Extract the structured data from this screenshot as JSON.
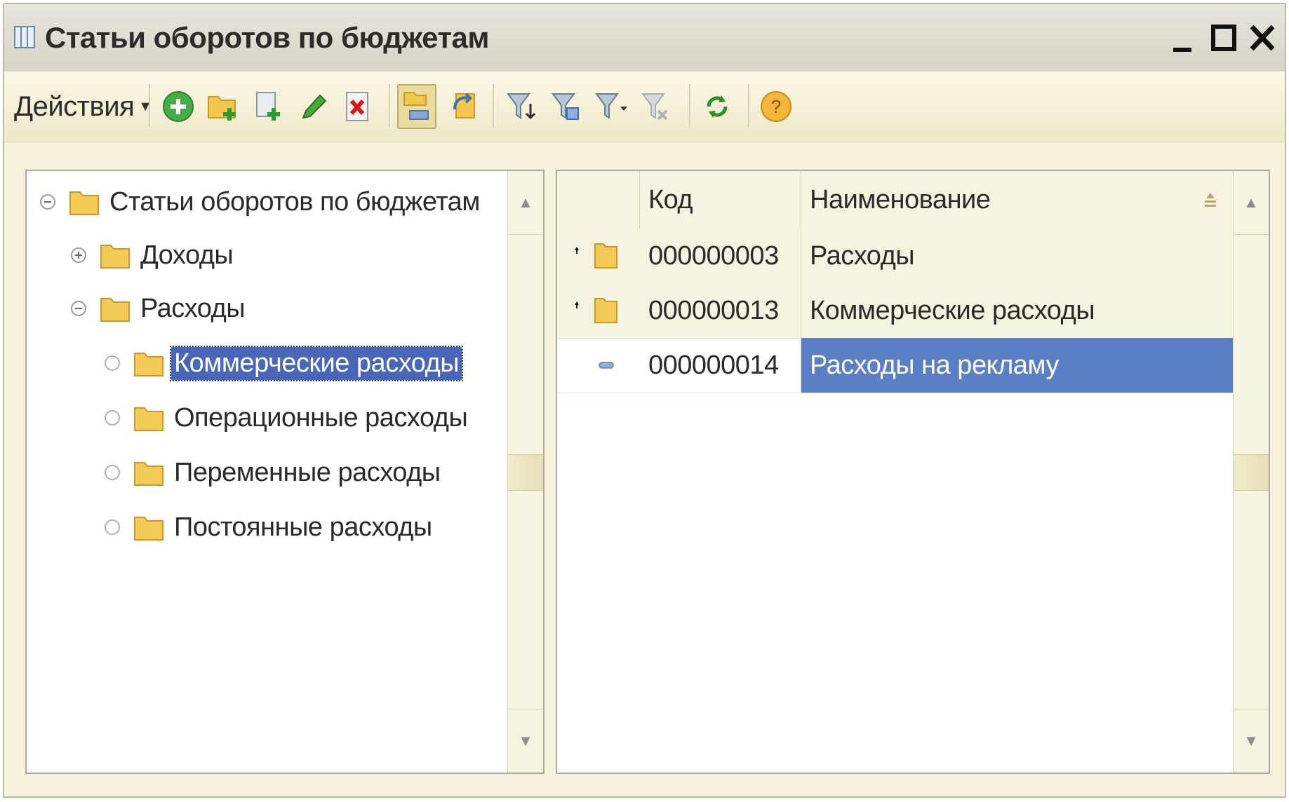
{
  "window": {
    "title": "Статьи оборотов по бюджетам",
    "minimize": "_",
    "close": "X"
  },
  "toolbar": {
    "actions_label": "Действия",
    "buttons": [
      {
        "name": "add-icon"
      },
      {
        "name": "add-group-icon"
      },
      {
        "name": "copy-icon"
      },
      {
        "name": "edit-icon"
      },
      {
        "name": "delete-icon"
      },
      {
        "name": "hierarchy-icon"
      },
      {
        "name": "level-up-icon"
      },
      {
        "name": "filter-icon"
      },
      {
        "name": "filter-by-value-icon"
      },
      {
        "name": "filter-history-icon"
      },
      {
        "name": "clear-filter-icon"
      },
      {
        "name": "refresh-icon"
      },
      {
        "name": "help-icon"
      }
    ],
    "accent": "#3aa43a"
  },
  "tree": {
    "items": [
      {
        "label": "Статьи оборотов по бюджетам",
        "level": 0,
        "state": "expanded"
      },
      {
        "label": "Доходы",
        "level": 1,
        "state": "collapsed"
      },
      {
        "label": "Расходы",
        "level": 1,
        "state": "expanded"
      },
      {
        "label": "Коммерческие расходы",
        "level": 2,
        "state": "leaf",
        "selected": true
      },
      {
        "label": "Операционные расходы",
        "level": 2,
        "state": "leaf"
      },
      {
        "label": "Переменные расходы",
        "level": 2,
        "state": "leaf"
      },
      {
        "label": "Постоянные расходы",
        "level": 2,
        "state": "leaf"
      }
    ],
    "selection_color": "#4a66b8"
  },
  "table": {
    "columns": [
      "Код",
      "Наименование"
    ],
    "rows": [
      {
        "type": "group-up",
        "code": "000000003",
        "name": "Расходы"
      },
      {
        "type": "group-up",
        "code": "000000013",
        "name": "Коммерческие расходы"
      },
      {
        "type": "item",
        "code": "000000014",
        "name": "Расходы на рекламу",
        "selected": true
      }
    ],
    "selection_color": "#5b7fc4"
  }
}
